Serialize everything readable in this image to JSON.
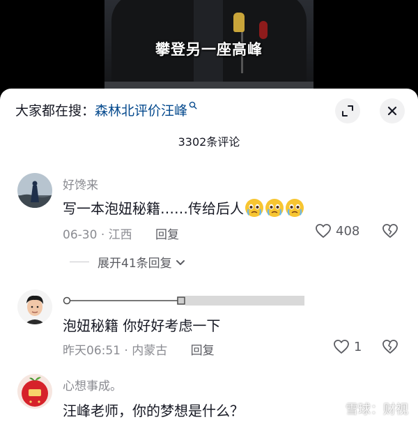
{
  "video": {
    "caption": "攀登另一座高峰"
  },
  "header": {
    "search_prefix": "大家都在搜：",
    "search_keyword": "森林北评价汪峰",
    "comment_count": "3302条评论"
  },
  "comments": [
    {
      "username": "好馋来",
      "text": "写一本泡妞秘籍……传给后人",
      "emoji_count": 3,
      "date": "06-30",
      "location": "江西",
      "reply_label": "回复",
      "likes": "408",
      "expand_label": "展开41条回复"
    },
    {
      "username": "",
      "text": "泡妞秘籍 你好好考虑一下",
      "date": "昨天06:51",
      "location": "内蒙古",
      "reply_label": "回复",
      "likes": "1"
    },
    {
      "username": "心想事成。",
      "text": "汪峰老师，你的梦想是什么？"
    }
  ],
  "watermark": {
    "text": "雪球：财视"
  },
  "icons": {
    "search": "search-icon",
    "collapse": "collapse-icon",
    "close": "close-icon",
    "like": "heart-icon",
    "dislike": "broken-heart-icon",
    "chevron": "chevron-down-icon"
  }
}
